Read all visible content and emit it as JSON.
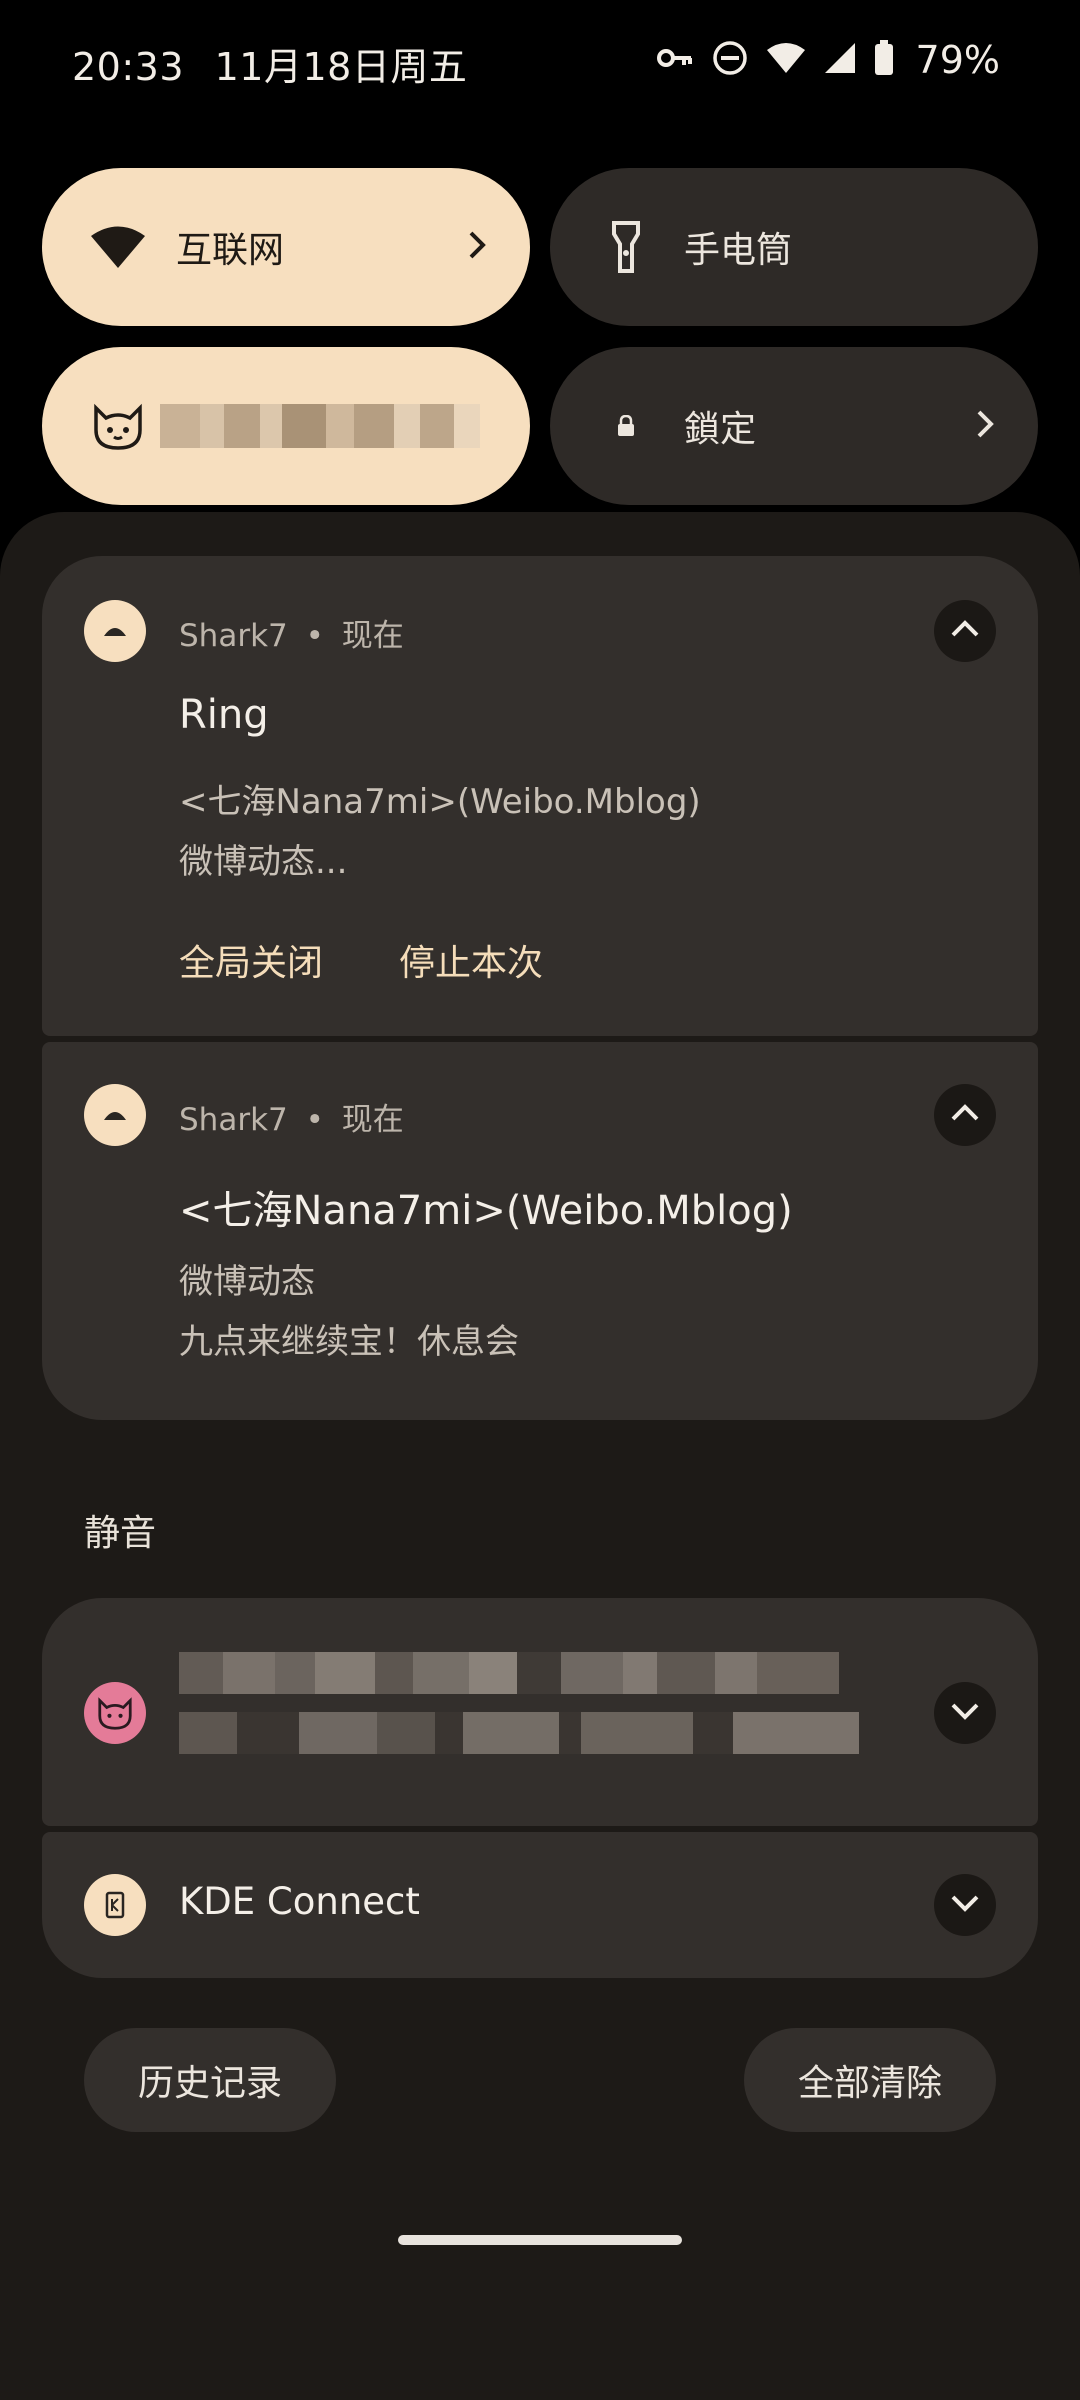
{
  "status": {
    "time": "20:33",
    "date": "11月18日周五",
    "battery": "79%"
  },
  "tiles": {
    "internet": "互联网",
    "flashlight": "手电筒",
    "lock": "鎖定"
  },
  "notifications": [
    {
      "app": "Shark7",
      "time": "现在",
      "title": "Ring",
      "line1": "<七海Nana7mi>(Weibo.Mblog)",
      "line2": "微博动态...",
      "actions": [
        "全局关闭",
        "停止本次"
      ]
    },
    {
      "app": "Shark7",
      "time": "现在",
      "title": "<七海Nana7mi>(Weibo.Mblog)",
      "line1": "微博动态",
      "line2": "九点来继续宝！休息会"
    }
  ],
  "silent": {
    "header": "静音",
    "kde": "KDE Connect"
  },
  "footer": {
    "history": "历史记录",
    "clear_all": "全部清除"
  },
  "colors": {
    "accent": "#f7dfbf",
    "card": "#332f2c",
    "shade": "#1d1a17"
  }
}
